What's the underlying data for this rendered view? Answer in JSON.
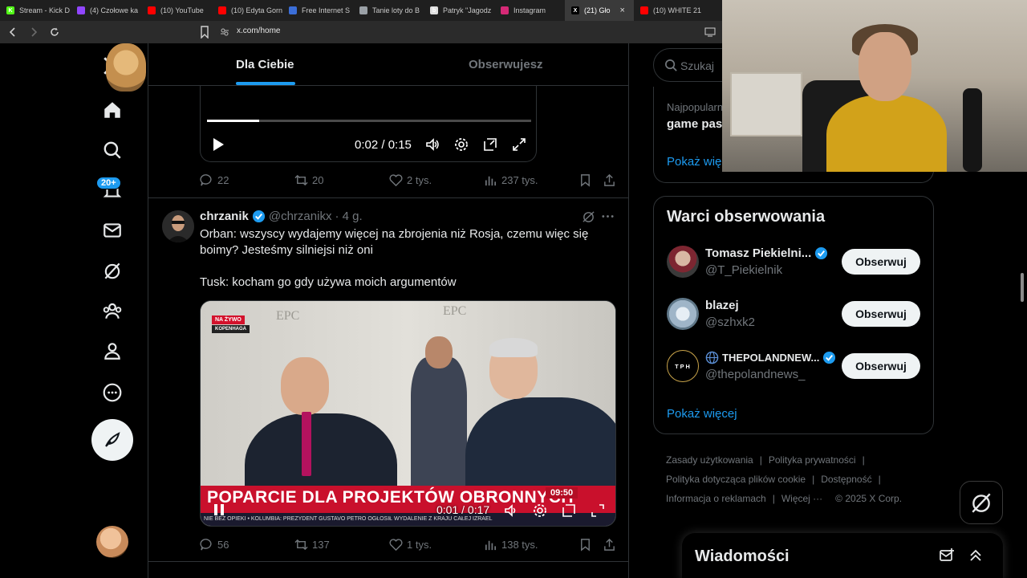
{
  "browser": {
    "tabs": [
      {
        "label": "Stream - Kick D",
        "color": "#53fc18",
        "glyph": "K"
      },
      {
        "label": "(4) Czołowe ka",
        "color": "#9146ff",
        "glyph": ""
      },
      {
        "label": "(10) YouTube",
        "color": "#ff0000",
        "glyph": ""
      },
      {
        "label": "(10) Edyta Gorn",
        "color": "#ff0000",
        "glyph": ""
      },
      {
        "label": "Free Internet S",
        "color": "#3b6ed8",
        "glyph": ""
      },
      {
        "label": "Tanie loty do B",
        "color": "#9aa0a6",
        "glyph": ""
      },
      {
        "label": "Patryk \"Jagodz",
        "color": "#e0e0e0",
        "glyph": "b"
      },
      {
        "label": "Instagram",
        "color": "#d62976",
        "glyph": ""
      },
      {
        "label": "(21) Gło",
        "color": "#000000",
        "glyph": "X"
      },
      {
        "label": "(10) WHITE 21 t",
        "color": "#ff0000",
        "glyph": ""
      }
    ],
    "active_tab_index": 8,
    "url": "x.com/home"
  },
  "nav": {
    "notifications_badge": "20+"
  },
  "timeline": {
    "tabs": [
      {
        "label": "Dla Ciebie",
        "active": true
      },
      {
        "label": "Obserwujesz",
        "active": false
      }
    ]
  },
  "tweet1": {
    "video": {
      "time": "0:02 / 0:15",
      "progress": 0.16
    },
    "stats": {
      "replies": "22",
      "reposts": "20",
      "likes": "2 tys.",
      "views": "237 tys."
    }
  },
  "tweet2": {
    "name": "chrzanik",
    "handle": "@chrzanikx",
    "age": "· 4 g.",
    "text_line1": "Orban: wszyscy wydajemy więcej na zbrojenia niż Rosja, czemu więc się boimy? Jesteśmy silniejsi niż oni",
    "text_line2": "Tusk: kocham go gdy używa moich argumentów",
    "video": {
      "time": "0:01 / 0:17",
      "live_badge": "NA ŻYWO",
      "live_location": "KOPENHAGA",
      "lower_third": "POPARCIE DLA PROJEKTÓW OBRONNYCH",
      "clock": "09:50",
      "ticker": "NIE BEZ OPIEKI • KOLUMBIA: PREZYDENT GUSTAVO PETRO OGŁOSIŁ WYDALENIE Z KRAJU CAŁEJ IZRAEL",
      "epc_text": "EPC"
    },
    "stats": {
      "replies": "56",
      "reposts": "137",
      "likes": "1 tys.",
      "views": "138 tys."
    }
  },
  "sidebar": {
    "search_placeholder": "Szukaj",
    "trend": {
      "category": "Najpopularn",
      "name": "game pas",
      "more": "Pokaż wię"
    },
    "who_to_follow": {
      "title": "Warci obserwowania",
      "users": [
        {
          "name": "Tomasz Piekielni...",
          "handle": "@T_Piekielnik",
          "button": "Obserwuj"
        },
        {
          "name": "blazej",
          "handle": "@szhxk2",
          "button": "Obserwuj"
        },
        {
          "name": "THEPOLANDNEW...",
          "handle": "@thepolandnews_",
          "button": "Obserwuj"
        }
      ],
      "more": "Pokaż więcej"
    },
    "footer": {
      "links": [
        "Zasady użytkowania",
        "Polityka prywatności",
        "Polityka dotycząca plików cookie",
        "Dostępność",
        "Informacja o reklamach",
        "Więcej ···"
      ],
      "copyright": "© 2025 X Corp."
    }
  },
  "messages": {
    "title": "Wiadomości"
  },
  "colors": {
    "accent": "#1d9bf0",
    "background": "#000000",
    "border": "#2f3336",
    "muted": "#71767b"
  }
}
